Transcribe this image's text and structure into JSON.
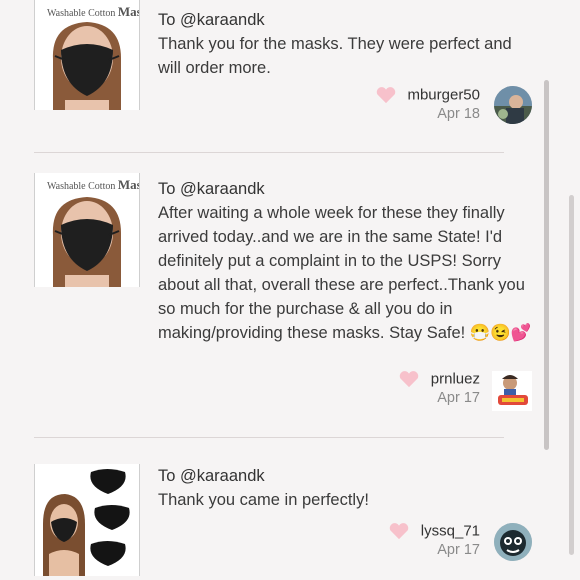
{
  "reviews": [
    {
      "thumb_caption_small": "Washable Cotton",
      "thumb_caption_big": "Mask",
      "to": "To @karaandk",
      "text": "Thank you for the masks. They were perfect and will order more.",
      "user": "mburger50",
      "date": "Apr 18"
    },
    {
      "thumb_caption_small": "Washable Cotton",
      "thumb_caption_big": "Mask",
      "to": "To @karaandk",
      "text": "After waiting a whole week for these they finally arrived today..and we are in the same State! I'd definitely put a complaint in to the USPS! Sorry about all that, overall these are perfect..Thank you so much for the purchase & all you do in making/providing these masks. Stay Safe! 😷😉💕",
      "user": "prnluez",
      "date": "Apr 17"
    },
    {
      "to": "To @karaandk",
      "text": "Thank you came in perfectly!",
      "user": "lyssq_71",
      "date": "Apr 17"
    }
  ],
  "icons": {
    "like": "heart-icon",
    "heart_color": "#f7c1cb"
  }
}
